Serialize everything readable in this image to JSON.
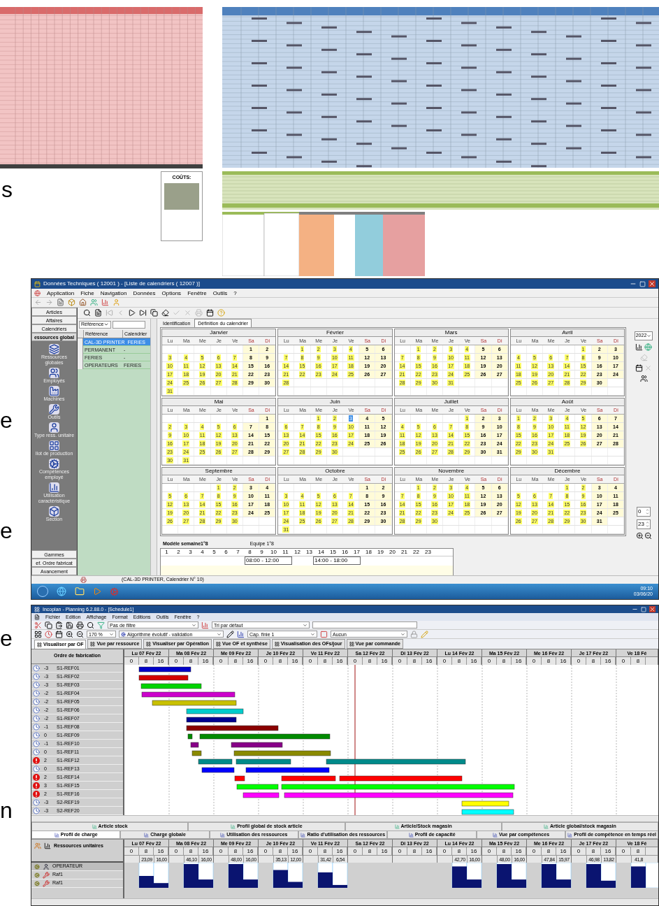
{
  "slide_fragments": [
    "s",
    "e",
    "e",
    "e",
    "n"
  ],
  "costs_label": "COÛTS:",
  "calendar_window": {
    "title": "Données Techniques ( 12001 ) - [Liste de calendriers ( 12007 )]",
    "menu": [
      "Application",
      "Fiche",
      "Navigation",
      "Données",
      "Options",
      "Fenêtre",
      "Outils",
      "?"
    ],
    "nav_top": [
      {
        "label": "Articles",
        "selected": false
      },
      {
        "label": "Affaires",
        "selected": false
      },
      {
        "label": "Calendriers",
        "selected": false
      },
      {
        "label": "essources global",
        "selected": true
      }
    ],
    "nav_items": [
      "Ressources globales",
      "Employés",
      "Machines",
      "Outils",
      "Type ress. unitaire",
      "Ilot de production",
      "Compétences employé",
      "Utilisation caractéristique",
      "Section"
    ],
    "nav_bottom": [
      "Gammes",
      "ef. Ordre fabricat",
      "Avancement"
    ],
    "search_field": "Référence",
    "list_columns": [
      "Référence",
      "Calendrier"
    ],
    "list_rows": [
      {
        "reference": "CAL-3D PRINTER",
        "calendar": "FERIES",
        "selected": true
      },
      {
        "reference": "PERMANENT",
        "calendar": "-",
        "selected": false
      },
      {
        "reference": "FERIES",
        "calendar": "-",
        "selected": false
      },
      {
        "reference": "OPERATEURS",
        "calendar": "FERIES",
        "selected": false
      }
    ],
    "tabs": [
      {
        "label": "Identification",
        "selected": false
      },
      {
        "label": "Définition du calendrier",
        "selected": true
      }
    ],
    "year": "2022",
    "months": [
      {
        "name": "Janvier",
        "weekdays": [
          "Lu",
          "Ma",
          "Me",
          "Je",
          "Ve",
          "Sa",
          "Di"
        ],
        "weeks": [
          [
            "1",
            "2"
          ],
          [
            "3",
            "4",
            "5",
            "6",
            "7",
            "8",
            "9"
          ],
          [
            "10",
            "11",
            "12",
            "13",
            "14",
            "15",
            "16"
          ],
          [
            "17",
            "18",
            "19",
            "20",
            "21",
            "22",
            "23"
          ],
          [
            "24",
            "25",
            "26",
            "27",
            "28",
            "29",
            "30"
          ],
          [
            "31"
          ]
        ]
      },
      {
        "name": "Février",
        "weekdays": [
          "Lu",
          "Ma",
          "Me",
          "Je",
          "Ve",
          "Sa",
          "Di"
        ],
        "weeks": [
          [
            "1",
            "2",
            "3",
            "4",
            "5",
            "6"
          ],
          [
            "7",
            "8",
            "9",
            "10",
            "11",
            "12",
            "13"
          ],
          [
            "14",
            "15",
            "16",
            "17",
            "18",
            "19",
            "20"
          ],
          [
            "21",
            "22",
            "23",
            "24",
            "25",
            "26",
            "27"
          ],
          [
            "28"
          ]
        ]
      },
      {
        "name": "Mars",
        "weekdays": [
          "Lu",
          "Ma",
          "Me",
          "Je",
          "Ve",
          "Sa",
          "Di"
        ],
        "weeks": [
          [
            "1",
            "2",
            "3",
            "4",
            "5",
            "6"
          ],
          [
            "7",
            "8",
            "9",
            "10",
            "11",
            "12",
            "13"
          ],
          [
            "14",
            "15",
            "16",
            "17",
            "18",
            "19",
            "20"
          ],
          [
            "21",
            "22",
            "23",
            "24",
            "25",
            "26",
            "27"
          ],
          [
            "28",
            "29",
            "30",
            "31"
          ]
        ]
      },
      {
        "name": "Avril",
        "weekdays": [
          "Lu",
          "Ma",
          "Me",
          "Je",
          "Ve",
          "Sa",
          "Di"
        ],
        "weeks": [
          [
            "1",
            "2",
            "3"
          ],
          [
            "4",
            "5",
            "6",
            "7",
            "8",
            "9",
            "10"
          ],
          [
            "11",
            "12",
            "13",
            "14",
            "15",
            "16",
            "17"
          ],
          [
            "18",
            "19",
            "20",
            "21",
            "22",
            "23",
            "24"
          ],
          [
            "25",
            "26",
            "27",
            "28",
            "29",
            "30"
          ]
        ]
      },
      {
        "name": "Mai",
        "weekdays": [
          "Lu",
          "Ma",
          "Me",
          "Je",
          "Ve",
          "Sa",
          "Di"
        ],
        "weeks": [
          [
            "1"
          ],
          [
            "2",
            "3",
            "4",
            "5",
            "6",
            "7",
            "8"
          ],
          [
            "9",
            "10",
            "11",
            "12",
            "13",
            "14",
            "15"
          ],
          [
            "16",
            "17",
            "18",
            "19",
            "20",
            "21",
            "22"
          ],
          [
            "23",
            "24",
            "25",
            "26",
            "27",
            "28",
            "29"
          ],
          [
            "30",
            "31"
          ]
        ]
      },
      {
        "name": "Juin",
        "weekdays": [
          "Lu",
          "Ma",
          "Me",
          "Je",
          "Ve",
          "Sa",
          "Di"
        ],
        "weeks": [
          [
            "1",
            "2",
            {
              "label": "3",
              "selected": true
            },
            "4",
            "5"
          ],
          [
            "6",
            "7",
            "8",
            "9",
            "10",
            "11",
            "12"
          ],
          [
            "13",
            "14",
            "15",
            "16",
            "17",
            "18",
            "19"
          ],
          [
            "20",
            "21",
            "22",
            "23",
            "24",
            "25",
            "26"
          ],
          [
            "27",
            "28",
            "29",
            "30"
          ]
        ]
      },
      {
        "name": "Juillet",
        "weekdays": [
          "Lu",
          "Ma",
          "Me",
          "Je",
          "Ve",
          "Sa",
          "Di"
        ],
        "weeks": [
          [
            "1",
            "2",
            "3"
          ],
          [
            "4",
            "5",
            "6",
            "7",
            "8",
            "9",
            "10"
          ],
          [
            "11",
            "12",
            "13",
            "14",
            "15",
            "16",
            "17"
          ],
          [
            "18",
            "19",
            "20",
            "21",
            "22",
            "23",
            "24"
          ],
          [
            "25",
            "26",
            "27",
            "28",
            "29",
            "30",
            "31"
          ]
        ]
      },
      {
        "name": "Août",
        "weekdays": [
          "Lu",
          "Ma",
          "Me",
          "Je",
          "Ve",
          "Sa",
          "Di"
        ],
        "weeks": [
          [
            "1",
            "2",
            "3",
            "4",
            "5",
            "6",
            "7"
          ],
          [
            "8",
            "9",
            "10",
            "11",
            "12",
            "13",
            "14"
          ],
          [
            "15",
            "16",
            "17",
            "18",
            "19",
            "20",
            "21"
          ],
          [
            "22",
            "23",
            "24",
            "25",
            "26",
            "27",
            "28"
          ],
          [
            "29",
            "30",
            "31"
          ]
        ]
      },
      {
        "name": "Septembre",
        "weekdays": [
          "Lu",
          "Ma",
          "Me",
          "Je",
          "Ve",
          "Sa",
          "Di"
        ],
        "weeks": [
          [
            "1",
            "2",
            "3",
            "4"
          ],
          [
            "5",
            "6",
            "7",
            "8",
            "9",
            "10",
            "11"
          ],
          [
            "12",
            "13",
            "14",
            "15",
            "16",
            "17",
            "18"
          ],
          [
            "19",
            "20",
            "21",
            "22",
            "23",
            "24",
            "25"
          ],
          [
            "26",
            "27",
            "28",
            "29",
            "30"
          ]
        ]
      },
      {
        "name": "Octobre",
        "weekdays": [
          "Lu",
          "Ma",
          "Me",
          "Je",
          "Ve",
          "Sa",
          "Di"
        ],
        "weeks": [
          [
            "1",
            "2"
          ],
          [
            "3",
            "4",
            "5",
            "6",
            "7",
            "8",
            "9"
          ],
          [
            "10",
            "11",
            "12",
            "13",
            "14",
            "15",
            "16"
          ],
          [
            "17",
            "18",
            "19",
            "20",
            "21",
            "22",
            "23"
          ],
          [
            "24",
            "25",
            "26",
            "27",
            "28",
            "29",
            "30"
          ],
          [
            "31"
          ]
        ]
      },
      {
        "name": "Novembre",
        "weekdays": [
          "Lu",
          "Ma",
          "Me",
          "Je",
          "Ve",
          "Sa",
          "Di"
        ],
        "weeks": [
          [
            "1",
            "2",
            "3",
            "4",
            "5",
            "6"
          ],
          [
            "7",
            "8",
            "9",
            "10",
            "11",
            "12",
            "13"
          ],
          [
            "14",
            "15",
            "16",
            "17",
            "18",
            "19",
            "20"
          ],
          [
            "21",
            "22",
            "23",
            "24",
            "25",
            "26",
            "27"
          ],
          [
            "28",
            "29",
            "30"
          ]
        ]
      },
      {
        "name": "Décembre",
        "weekdays": [
          "Lu",
          "Ma",
          "Me",
          "Je",
          "Ve",
          "Sa",
          "Di"
        ],
        "weeks": [
          [
            "1",
            "2",
            "3",
            "4"
          ],
          [
            "5",
            "6",
            "7",
            "8",
            "9",
            "10",
            "11"
          ],
          [
            "12",
            "13",
            "14",
            "15",
            "16",
            "17",
            "18"
          ],
          [
            "19",
            "20",
            "21",
            "22",
            "23",
            "24",
            "25"
          ],
          [
            "26",
            "27",
            "28",
            "29",
            "30",
            "31"
          ]
        ]
      }
    ],
    "week_model_label": "Modèle semaine1°8",
    "team_label": "Equipe 1°8",
    "hours": [
      "1",
      "2",
      "3",
      "4",
      "5",
      "6",
      "7",
      "8",
      "9",
      "10",
      "11",
      "12",
      "13",
      "14",
      "15",
      "16",
      "17",
      "18",
      "19",
      "20",
      "21",
      "22",
      "23"
    ],
    "shifts": [
      "08:00 - 12:00",
      "14:00 - 18:00"
    ],
    "spinners": [
      "0",
      "23"
    ],
    "status": "(CAL-3D PRINTER, Calendrier N° 10)",
    "clock": {
      "time": "09:10",
      "date": "03/06/20"
    }
  },
  "planning_window": {
    "title": "Incoplan - Planning 6.2.88.0 - [Schedule1]",
    "menu": [
      "Fichier",
      "Edition",
      "Affichage",
      "Format",
      "Editions",
      "Outils",
      "Fenêtre",
      "?"
    ],
    "filter": "Pas de filtre",
    "sort": "Tri par défaut",
    "zoom": "170 %",
    "algorithm": "Algorithme évolutif - validation",
    "capacity": "Cap. finie 1",
    "option": "Aucun",
    "tabs": [
      {
        "label": "Visualiser par OF",
        "selected": true
      },
      {
        "label": "Vue par ressource",
        "selected": false
      },
      {
        "label": "Visualiser par Opération",
        "selected": false
      },
      {
        "label": "Vue OF et synthèse",
        "selected": false
      },
      {
        "label": "Visualisation des OFs/jour",
        "selected": false
      },
      {
        "label": "Vue par commande",
        "selected": false
      }
    ],
    "order_column": "Ordre de fabrication",
    "days": [
      {
        "label": "Lu 07 Fév 22",
        "hours": [
          "0",
          "8",
          "16"
        ]
      },
      {
        "label": "Ma 08 Fév 22",
        "hours": [
          "0",
          "8",
          "16"
        ]
      },
      {
        "label": "Me 09 Fév 22",
        "hours": [
          "0",
          "8",
          "16"
        ]
      },
      {
        "label": "Je 10 Fév 22",
        "hours": [
          "0",
          "8",
          "16"
        ]
      },
      {
        "label": "Ve 11 Fév 22",
        "hours": [
          "0",
          "8",
          "16"
        ]
      },
      {
        "label": "Sa 12 Fév 22",
        "hours": [
          "0",
          "8",
          "16"
        ]
      },
      {
        "label": "Di 13 Fév 22",
        "hours": [
          "0",
          "8",
          "16"
        ]
      },
      {
        "label": "Lu 14 Fév 22",
        "hours": [
          "0",
          "8",
          "16"
        ]
      },
      {
        "label": "Ma 15 Fév 22",
        "hours": [
          "0",
          "8",
          "16"
        ]
      },
      {
        "label": "Me 16 Fév 22",
        "hours": [
          "0",
          "8",
          "16"
        ]
      },
      {
        "label": "Je 17 Fév 22",
        "hours": [
          "0",
          "8",
          "16"
        ]
      },
      {
        "label": "Ve 18 Fé",
        "hours": [
          "0",
          "8"
        ]
      }
    ],
    "orders": [
      {
        "kind": "clock",
        "delay": "-3",
        "name": "S1-REF01",
        "color": "#0000c8"
      },
      {
        "kind": "clock",
        "delay": "-3",
        "name": "S1-REF02",
        "color": "#d40000"
      },
      {
        "kind": "clock",
        "delay": "-3",
        "name": "S1-REF03",
        "color": "#00d400"
      },
      {
        "kind": "clock",
        "delay": "-2",
        "name": "S1-REF04",
        "color": "#cc00cc"
      },
      {
        "kind": "clock",
        "delay": "-2",
        "name": "S1-REF05",
        "color": "#c8c000"
      },
      {
        "kind": "clock",
        "delay": "-2",
        "name": "S1-REF06",
        "color": "#00cccc"
      },
      {
        "kind": "clock",
        "delay": "-2",
        "name": "S1-REF07",
        "color": "#000090"
      },
      {
        "kind": "clock",
        "delay": "-1",
        "name": "S1-REF08",
        "color": "#8a0000"
      },
      {
        "kind": "clock",
        "delay": "0",
        "name": "S1-REF09",
        "color": "#008a00"
      },
      {
        "kind": "clock",
        "delay": "-1",
        "name": "S1-REF10",
        "color": "#880088"
      },
      {
        "kind": "clock",
        "delay": "0",
        "name": "S1-REF11",
        "color": "#8a8a00"
      },
      {
        "kind": "alert",
        "delay": "2",
        "name": "S1-REF12",
        "color": "#008a8a"
      },
      {
        "kind": "clock",
        "delay": "0",
        "name": "S1-REF13",
        "color": "#0000ff"
      },
      {
        "kind": "alert",
        "delay": "2",
        "name": "S1-REF14",
        "color": "#ff0000"
      },
      {
        "kind": "alert",
        "delay": "3",
        "name": "S1-REF15",
        "color": "#00ff00"
      },
      {
        "kind": "alert",
        "delay": "2",
        "name": "S1-REF16",
        "color": "#ff00ff"
      },
      {
        "kind": "clock",
        "delay": "-3",
        "name": "S2-REF19",
        "color": "#ffff00"
      },
      {
        "kind": "clock",
        "delay": "-3",
        "name": "S2-REF20",
        "color": "#00ffff"
      }
    ],
    "bottom_tabs_row1": [
      {
        "label": "Article stock",
        "selected": false
      },
      {
        "label": "Profil global de stock article",
        "selected": false
      },
      {
        "label": "Article/Stock magasin",
        "selected": false
      },
      {
        "label": "Article global/stock magasin",
        "selected": false
      }
    ],
    "bottom_tabs_row2": [
      {
        "label": "Profil de charge",
        "selected": true
      },
      {
        "label": "Charge globale",
        "selected": false
      },
      {
        "label": "Utilisation des ressources",
        "selected": false
      },
      {
        "label": "Ratio d'utilisation des ressources",
        "selected": false
      },
      {
        "label": "Profil de capacité",
        "selected": false
      },
      {
        "label": "Vue par compétences",
        "selected": false
      },
      {
        "label": "Profil de compétence en temps réel",
        "selected": false
      }
    ],
    "resources_column": "Ressources unitaires",
    "profile_days": [
      {
        "label": "Lu 07 Fév 22",
        "hours": [
          "0",
          "8",
          "16"
        ],
        "values": [
          "23,09",
          "16,00"
        ]
      },
      {
        "label": "Ma 08 Fév 22",
        "hours": [
          "0",
          "8",
          "16"
        ],
        "values": [
          "46,10",
          "16,00"
        ]
      },
      {
        "label": "Me 09 Fév 22",
        "hours": [
          "0",
          "8",
          "16"
        ],
        "values": [
          "48,00",
          "16,00"
        ]
      },
      {
        "label": "Je 10 Fév 22",
        "hours": [
          "0",
          "8",
          "16"
        ],
        "values": [
          "35,13",
          "12,00"
        ]
      },
      {
        "label": "Ve 11 Fév 22",
        "hours": [
          "0",
          "8",
          "16"
        ],
        "values": [
          "31,42",
          "6,54"
        ]
      },
      {
        "label": "Sa 12 Fév 22",
        "hours": [
          "0",
          "8",
          "16"
        ]
      },
      {
        "label": "Di 13 Fév 22",
        "hours": [
          "0",
          "8",
          "16"
        ]
      },
      {
        "label": "Lu 14 Fév 22",
        "hours": [
          "0",
          "8",
          "16"
        ],
        "values": [
          "42,70",
          "16,00"
        ]
      },
      {
        "label": "Ma 15 Fév 22",
        "hours": [
          "0",
          "8",
          "16"
        ],
        "values": [
          "48,00",
          "16,00"
        ]
      },
      {
        "label": "Me 16 Fév 22",
        "hours": [
          "0",
          "8",
          "16"
        ],
        "values": [
          "47,84",
          "15,97"
        ]
      },
      {
        "label": "Je 17 Fév 22",
        "hours": [
          "0",
          "8",
          "16"
        ],
        "values": [
          "46,98",
          "13,82"
        ]
      },
      {
        "label": "Ve 18 Fé",
        "hours": [
          "0",
          "8"
        ],
        "values": [
          "41,8"
        ]
      }
    ],
    "resources": [
      {
        "name": "OPERATEUR",
        "kind": "operator",
        "selected": true
      },
      {
        "name": "Raf1",
        "kind": "tool",
        "selected": false
      },
      {
        "name": "Raf1",
        "kind": "tool",
        "selected": false
      }
    ]
  }
}
